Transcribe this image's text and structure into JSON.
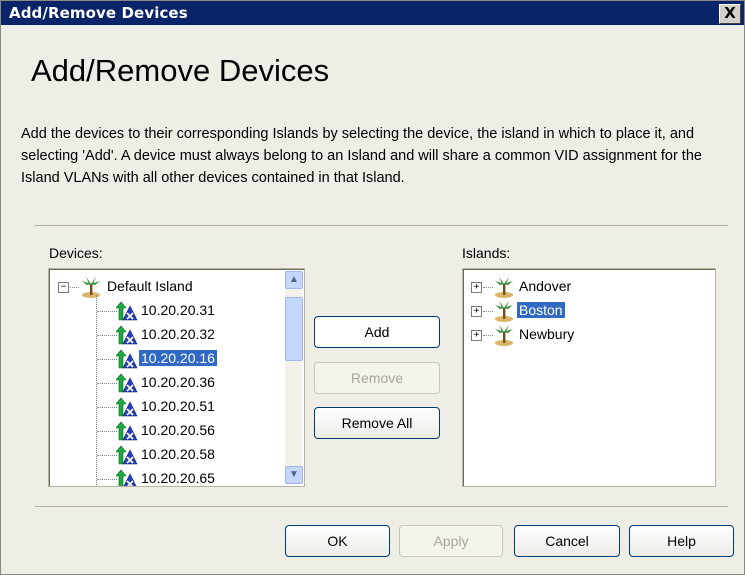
{
  "window": {
    "title": "Add/Remove Devices",
    "close_glyph": "X"
  },
  "heading": "Add/Remove Devices",
  "description": "Add the devices to their corresponding Islands by selecting the device, the island in which to place it, and selecting 'Add'. A device must always belong to an Island and will share a common VID assignment for the Island VLANs with all other devices contained in that Island.",
  "devices": {
    "label": "Devices:",
    "root": {
      "label": "Default Island",
      "expanded": true,
      "icon": "palm-tree-icon"
    },
    "items": [
      {
        "label": "10.20.20.31",
        "selected": false
      },
      {
        "label": "10.20.20.32",
        "selected": false
      },
      {
        "label": "10.20.20.16",
        "selected": true
      },
      {
        "label": "10.20.20.36",
        "selected": false
      },
      {
        "label": "10.20.20.51",
        "selected": false
      },
      {
        "label": "10.20.20.56",
        "selected": false
      },
      {
        "label": "10.20.20.58",
        "selected": false
      },
      {
        "label": "10.20.20.65",
        "selected": false
      }
    ]
  },
  "islands": {
    "label": "Islands:",
    "items": [
      {
        "label": "Andover",
        "selected": false
      },
      {
        "label": "Boston",
        "selected": true
      },
      {
        "label": "Newbury",
        "selected": false
      }
    ]
  },
  "actions": {
    "add": "Add",
    "remove": "Remove",
    "remove_all": "Remove All"
  },
  "footer": {
    "ok": "OK",
    "apply": "Apply",
    "cancel": "Cancel",
    "help": "Help"
  },
  "colors": {
    "selection": "#316ac5",
    "title_bar": "#0a246a",
    "dialog_bg": "#eeeee6"
  }
}
